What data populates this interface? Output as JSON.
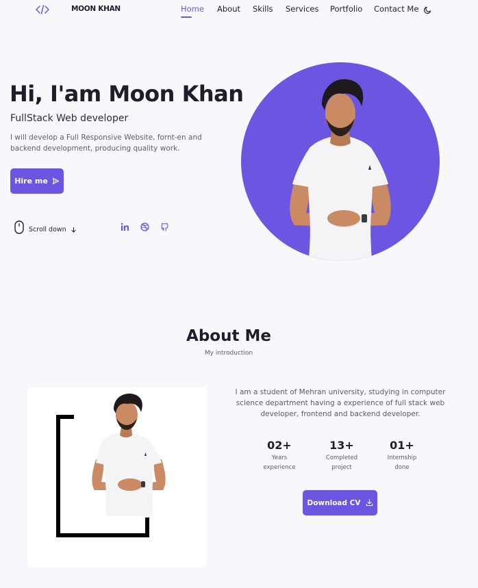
{
  "nav": {
    "brand": "MOON KHAN",
    "links": [
      {
        "label": "Home",
        "active": true
      },
      {
        "label": "About"
      },
      {
        "label": "Skills"
      },
      {
        "label": "Services"
      },
      {
        "label": "Portfolio"
      },
      {
        "label": "Contact Me"
      }
    ],
    "icons": {
      "logo": "code-icon",
      "theme": "moon-icon"
    }
  },
  "hero": {
    "title": "Hi, I'am Moon Khan",
    "subtitle": "FullStack Web developer",
    "description": "I will develop a Full Responsive Website, fornt-en and backend development, producing quality work.",
    "button_label": "Hire me",
    "button_icon": "send-icon",
    "scroll_label": "Scroll down",
    "socials": [
      "linkedin-icon",
      "dribbble-icon",
      "github-icon"
    ]
  },
  "about": {
    "title": "About Me",
    "subtitle": "My introduction",
    "description": "I am a student of Mehran university, studying in computer science department having a experience of full stack web developer, frontend and backend developer.",
    "stats": [
      {
        "number": "02+",
        "line1": "Years",
        "line2": "experience"
      },
      {
        "number": "13+",
        "line1": "Completed",
        "line2": "project"
      },
      {
        "number": "01+",
        "line1": "Internship",
        "line2": "done"
      }
    ],
    "button_label": "Download CV",
    "button_icon": "download-icon"
  },
  "colors": {
    "accent": "#6c55e0",
    "background": "#f8f8fc",
    "text": "#1f1d2b",
    "muted": "#5c5a6a"
  }
}
